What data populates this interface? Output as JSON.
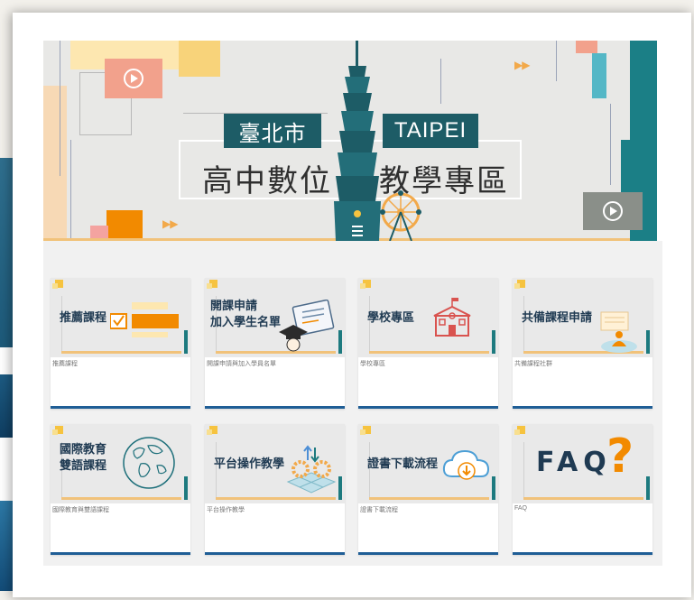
{
  "banner": {
    "label_city_zh": "臺北市",
    "label_city_en": "TAIPEI",
    "title_left": "高中數位",
    "title_right": "教學專區",
    "icons": [
      "play-icon",
      "play-icon",
      "taipei-101-tower",
      "ferris-wheel"
    ]
  },
  "cards": [
    {
      "title": "推薦課程",
      "caption": "推薦課程",
      "icon": "checkbox-icon"
    },
    {
      "title_line1": "開課申請",
      "title_line2": "加入學生名單",
      "caption": "開課申請與加入學員名單",
      "icon": "graduation-cap-icon"
    },
    {
      "title": "學校專區",
      "caption": "學校專區",
      "icon": "school-building-icon"
    },
    {
      "title": "共備課程申請",
      "caption": "共備課程社群",
      "icon": "presenter-icon"
    },
    {
      "title_line1": "國際教育",
      "title_line2": "雙語課程",
      "caption": "國際教育與雙語課程",
      "icon": "globe-icon"
    },
    {
      "title": "平台操作教學",
      "caption": "平台操作教學",
      "icon": "gears-icon"
    },
    {
      "title": "證書下載流程",
      "caption": "證書下載流程",
      "icon": "cloud-download-icon"
    },
    {
      "title": "FAQ",
      "caption": "FAQ",
      "icon": "question-mark-icon"
    }
  ],
  "colors": {
    "teal": "#1d5c66",
    "card_border": "#1f5e96",
    "accent_yellow": "#f6c33f",
    "accent_orange": "#f28a00",
    "salmon": "#f2a18c"
  }
}
